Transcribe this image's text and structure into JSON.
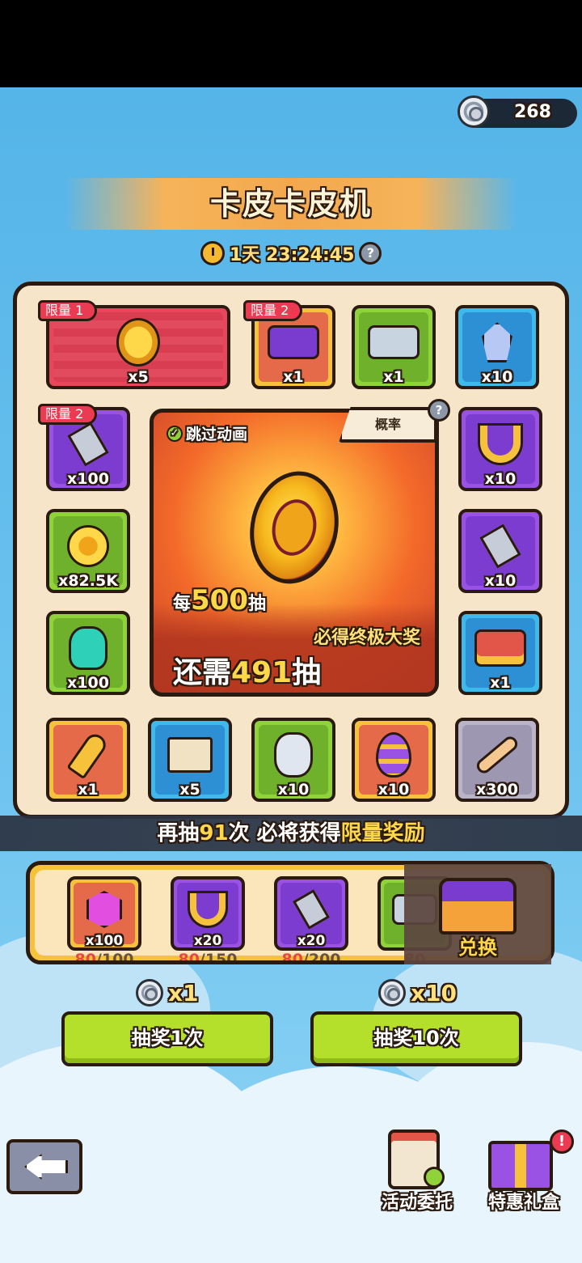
{
  "currency": {
    "amount": "268"
  },
  "title": "卡皮卡皮机",
  "timer": {
    "text": "1天 23:24:45"
  },
  "board": {
    "top_row": [
      {
        "badge": "限量 1",
        "qty": "x5",
        "icon": "capybara-coin-icon"
      },
      {
        "badge": "限量 2",
        "qty": "x1",
        "icon": "purple-chest-icon"
      },
      {
        "qty": "x1",
        "icon": "silver-chest-icon"
      },
      {
        "qty": "x10",
        "icon": "crystal-icon"
      }
    ],
    "left_col": [
      {
        "badge": "限量 2",
        "qty": "x100",
        "icon": "hammer-icon"
      },
      {
        "qty": "x82.5K",
        "icon": "gold-coin-icon"
      },
      {
        "qty": "x100",
        "icon": "teal-gem-icon"
      }
    ],
    "right_col": [
      {
        "qty": "x10",
        "icon": "horseshoe-icon"
      },
      {
        "qty": "x10",
        "icon": "hammer-icon"
      },
      {
        "qty": "x1",
        "icon": "red-chest-icon"
      }
    ],
    "bottom_row": [
      {
        "qty": "x1",
        "icon": "key-icon"
      },
      {
        "qty": "x5",
        "icon": "scroll-icon"
      },
      {
        "qty": "x10",
        "icon": "rune-stone-icon"
      },
      {
        "qty": "x10",
        "icon": "egg-icon"
      },
      {
        "qty": "x300",
        "icon": "bone-icon"
      }
    ]
  },
  "feature": {
    "skip_label": "跳过动画",
    "prob_label": "概率",
    "help": "?",
    "per_prefix": "每",
    "per_num": "500",
    "per_suffix": "抽",
    "guarantee": "必得终极大奖",
    "remaining_prefix": "还需",
    "remaining_num": "491",
    "remaining_suffix": "抽"
  },
  "strip": {
    "p1": "再抽",
    "num": "91",
    "p2": "次 必将获得",
    "highlight": "限量奖励"
  },
  "exchange": {
    "items": [
      {
        "qty": "x100",
        "cur": "80",
        "total": "/100",
        "icon": "pink-gem-icon"
      },
      {
        "qty": "x20",
        "cur": "80",
        "total": "/150",
        "icon": "horseshoe-icon"
      },
      {
        "qty": "x20",
        "cur": "80",
        "total": "/200",
        "icon": "hammer-icon"
      },
      {
        "qty": "",
        "cur": "80",
        "total": "",
        "icon": "silver-chest-icon"
      }
    ],
    "redeem_label": "兑换"
  },
  "draw": {
    "single": {
      "cost": "x1",
      "label": "抽奖1次"
    },
    "ten": {
      "cost": "x10",
      "label": "抽奖10次"
    }
  },
  "bottom": {
    "tasks_label": "活动委托",
    "gift_label": "特惠礼盒",
    "gift_notice": "!"
  },
  "colors": {
    "sky": "#6cc3ef",
    "gold": "#ffd84a",
    "button_green": "#b4df2a",
    "limit_red": "#ea3b53"
  }
}
